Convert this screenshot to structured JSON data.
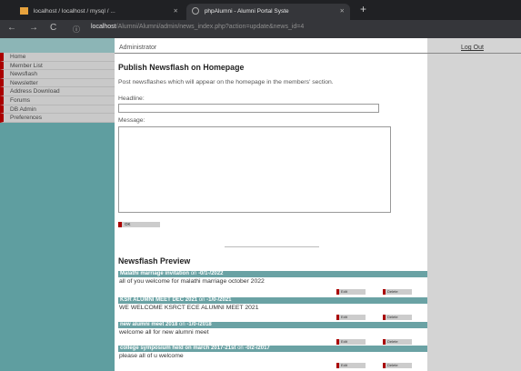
{
  "browser": {
    "tabs": [
      {
        "title": "localhost / localhost / mysql / ..."
      },
      {
        "title": "phpAlumni - Alumni Portal Syste"
      }
    ],
    "new_tab": "+",
    "url_host": "localhost",
    "url_path": "/Alumni/Alumni/admin/news_index.php?action=update&news_id=4"
  },
  "header": {
    "user": "Administrator",
    "logout": "Log Out"
  },
  "sidebar": {
    "items": [
      {
        "label": "Home"
      },
      {
        "label": "Member List"
      },
      {
        "label": "Newsflash"
      },
      {
        "label": "Newsletter"
      },
      {
        "label": "Address Download"
      },
      {
        "label": "Forums"
      },
      {
        "label": "DB Admin"
      },
      {
        "label": "Preferences"
      }
    ]
  },
  "form": {
    "title": "Publish Newsflash on Homepage",
    "intro": "Post newsflashes which will appear on the homepage in the members' section.",
    "headline_label": "Headline:",
    "headline_value": "",
    "message_label": "Message:",
    "message_value": "",
    "ok_label": "OK"
  },
  "preview": {
    "title": "Newsflash Preview",
    "edit_label": "Edit",
    "delete_label": "Delete",
    "on_word": "on",
    "items": [
      {
        "title": "Malathi marriage invitation",
        "date": "-0/1-/2022",
        "body": "all of you welcome for malathi marriage october 2022"
      },
      {
        "title": "KSR ALUMNI MEET DEC 2021",
        "date": "-1/0-/2021",
        "body": "WE WELCOME KSRCT ECE ALUMNI MEET 2021"
      },
      {
        "title": "new alumni meet 2018",
        "date": "-1/0-/2018",
        "body": "welcome all for new alumni meet"
      },
      {
        "title": "college symposium held on march 2017-21st",
        "date": "-0/2-/2017",
        "body": "please all of u welcome"
      }
    ]
  }
}
